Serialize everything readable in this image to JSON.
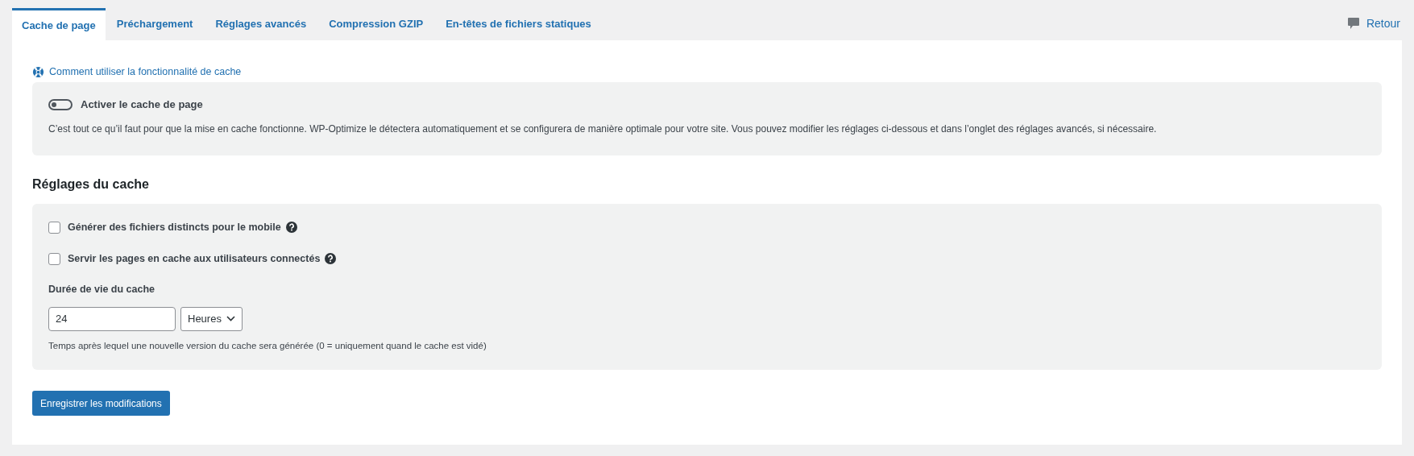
{
  "tabs": [
    {
      "label": "Cache de page",
      "selected": true
    },
    {
      "label": "Préchargement",
      "selected": false
    },
    {
      "label": "Réglages avancés",
      "selected": false
    },
    {
      "label": "Compression GZIP",
      "selected": false
    },
    {
      "label": "En-têtes de fichiers statiques",
      "selected": false
    }
  ],
  "feedback_link": "Retour",
  "help_link": "Comment utiliser la fonctionnalité de cache",
  "enable_cache": {
    "label": "Activer le cache de page",
    "on": false,
    "description": "C’est tout ce qu’il faut pour que la mise en cache fonctionne. WP-Optimize le détectera automatiquement et se configurera de manière optimale pour votre site. Vous pouvez modifier les réglages ci-dessous et dans l’onglet des réglages avancés, si nécessaire."
  },
  "cache_settings": {
    "heading": "Réglages du cache",
    "options": [
      {
        "label": "Générer des fichiers distincts pour le mobile",
        "checked": false
      },
      {
        "label": "Servir les pages en cache aux utilisateurs connectés",
        "checked": false
      }
    ],
    "lifespan": {
      "label": "Durée de vie du cache",
      "value": "24",
      "unit": "Heures",
      "hint": "Temps après lequel une nouvelle version du cache sera générée (0 = uniquement quand le cache est vidé)"
    }
  },
  "save_button": "Enregistrer les modifications"
}
